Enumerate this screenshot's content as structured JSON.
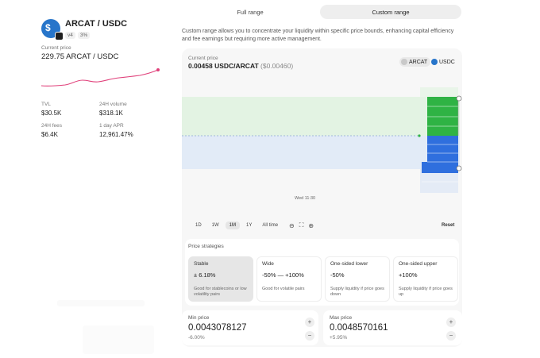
{
  "pool": {
    "pair": "ARCAT / USDC",
    "version": "v4",
    "fee": "3%",
    "current_price_label": "Current price",
    "current_price": "229.75 ARCAT / USDC",
    "stats": [
      {
        "label": "TVL",
        "value": "$30.5K"
      },
      {
        "label": "24H volume",
        "value": "$318.1K"
      },
      {
        "label": "24H fees",
        "value": "$6.4K"
      },
      {
        "label": "1 day APR",
        "value": "12,961.47%"
      }
    ],
    "accent": "#e0407a"
  },
  "range_toggle": {
    "full": "Full range",
    "custom": "Custom range",
    "selected": "custom"
  },
  "description": "Custom range allows you to concentrate your liquidity within specific price bounds, enhancing capital efficiency and fee earnings but requiring more active management.",
  "chart_panel": {
    "current_price_label": "Current price",
    "current_price": "0.00458 USDC/ARCAT",
    "current_price_usd": "($0.00460)",
    "tokens": [
      "ARCAT",
      "USDC"
    ],
    "time_label": "Wed 11:30",
    "time_ranges": [
      "1D",
      "1W",
      "1M",
      "1Y",
      "All time"
    ],
    "selected_time_range": "1M",
    "reset_label": "Reset",
    "colors": {
      "upper": "#2fb344",
      "lower": "#2f6fde",
      "upper_band": "#e3f3e3",
      "lower_band": "#e2ebf7"
    }
  },
  "strategies": {
    "title": "Price strategies",
    "items": [
      {
        "name": "Stable",
        "value": "± 6.18%",
        "desc": "Good for stablecoins or low volatility pairs",
        "selected": true
      },
      {
        "name": "Wide",
        "value": "-50% — +100%",
        "desc": "Good for volatile pairs",
        "selected": false
      },
      {
        "name": "One-sided lower",
        "value": "-50%",
        "desc": "Supply liquidity if price goes down",
        "selected": false
      },
      {
        "name": "One-sided upper",
        "value": "+100%",
        "desc": "Supply liquidity if price goes up",
        "selected": false
      }
    ]
  },
  "min_price": {
    "label": "Min price",
    "value": "0.0043078127",
    "pct": "-6.00%"
  },
  "max_price": {
    "label": "Max price",
    "value": "0.0048570161",
    "pct": "+5.95%"
  }
}
